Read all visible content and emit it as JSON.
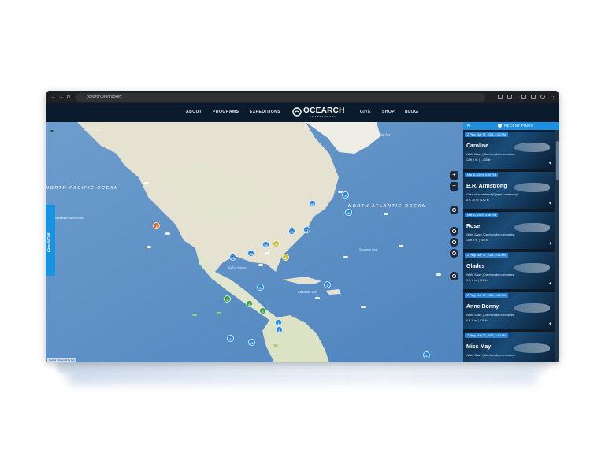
{
  "browser": {
    "url": "ocearch.org/tracker/",
    "nav_icons": [
      "back-icon",
      "forward-icon",
      "reload-icon"
    ]
  },
  "site_nav": {
    "links": [
      "ABOUT",
      "PROGRAMS",
      "EXPEDITIONS",
      "GIVE",
      "SHOP",
      "BLOG"
    ],
    "logo_text": "OCEARCH",
    "logo_tagline": "DATA TO SAVE FISH"
  },
  "map": {
    "ocean_labels": [
      "NORTH PACIFIC OCEAN",
      "NORTH ATLANTIC OCEAN"
    ],
    "small_labels": [
      "Gulf of Alaska",
      "Northeast Pacific Basin",
      "Labrador Sea",
      "Sargasso Sea",
      "Gulf of Mexico",
      "Caribbean Sea"
    ],
    "give_button": "Give NOW",
    "attribution": "Leaflet | Powered by Esri",
    "clusters": [
      {
        "label": "4",
        "color": "orange"
      },
      {
        "label": "3",
        "color": "blue"
      },
      {
        "label": "26",
        "color": "blue"
      },
      {
        "label": "5",
        "color": "blue"
      },
      {
        "label": "17",
        "color": "blue"
      },
      {
        "label": "10",
        "color": "blue"
      },
      {
        "label": "13",
        "color": "blue"
      },
      {
        "label": "26",
        "color": "blue"
      },
      {
        "label": "56",
        "color": "blue"
      },
      {
        "label": "8",
        "color": "yellow"
      },
      {
        "label": "5",
        "color": "yellow"
      },
      {
        "label": "5",
        "color": "blue"
      },
      {
        "label": "2",
        "color": "blue"
      },
      {
        "label": "3",
        "color": "green"
      },
      {
        "label": "6",
        "color": "green"
      },
      {
        "label": "3",
        "color": "green"
      },
      {
        "label": "2",
        "color": "blue"
      },
      {
        "label": "3",
        "color": "blue"
      },
      {
        "label": "2",
        "color": "blue"
      },
      {
        "label": "21",
        "color": "blue"
      },
      {
        "label": "6",
        "color": "blue"
      }
    ]
  },
  "panel": {
    "title": "RECENT PINGS",
    "pings": [
      {
        "ping": "Z Ping: Mar 17, 2024, 8:23 PM",
        "name": "Caroline",
        "species": "White Shark (Carcharodon carcharias)",
        "stats": "12 ft 5 in. | 1,435 lb"
      },
      {
        "ping": "Mar 11, 2024, 5:30 PM",
        "name": "B.R. Armstrong",
        "species": "Great Hammerhead (Sphyrna mokarran)",
        "stats": "8 ft. 10 in. | 192 lb"
      },
      {
        "ping": "Mar 11, 2024, 3:58 PM",
        "name": "Rose",
        "species": "White Shark (Carcharodon carcharias)",
        "stats": "10 ft 5 in. | 500 lb"
      },
      {
        "ping": "Z Ping: Mar 17, 2024, 9:15 AM",
        "name": "Glades",
        "species": "White Shark (Carcharodon carcharias)",
        "stats": "9 ft. 8 in. | 396 lb"
      },
      {
        "ping": "Z Ping: Mar 17, 2024, 8:14 AM",
        "name": "Anne Bonny",
        "species": "White Shark (Carcharodon carcharias)",
        "stats": "9 ft. 9 in. | 425 lb"
      },
      {
        "ping": "Z Ping: Mar 17, 2024, 6:19 AM",
        "name": "Miss May",
        "species": "White Shark (Carcharodon carcharias)",
        "stats": ""
      }
    ]
  },
  "colors": {
    "accent": "#1d8fe0",
    "nav_bg": "#0b1b2e",
    "ocean": "#5b8fc4",
    "land": "#e8e4d6"
  }
}
